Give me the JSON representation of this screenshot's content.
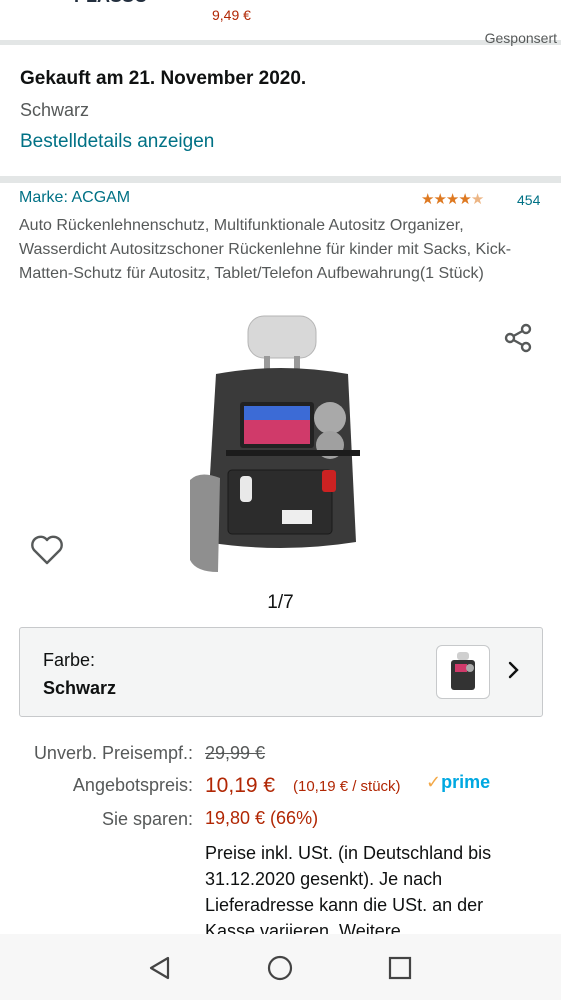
{
  "top": {
    "logo_text": "PLASSO",
    "price": "9,49 €",
    "sponsored": "Gesponsert"
  },
  "order": {
    "title": "Gekauft am 21. November 2020.",
    "color": "Schwarz",
    "details_link": "Bestelldetails anzeigen"
  },
  "product": {
    "brand": "Marke: ACGAM",
    "rating_stars": 4.5,
    "rating_count": "454",
    "title": "Auto Rückenlehnenschutz, Multifunktionale Autositz Organizer, Wasserdicht Autositzschoner Rückenlehne für kinder mit Sacks, Kick-Matten-Schutz für Autositz, Tablet/Telefon Aufbewahrung(1 Stück)",
    "image_counter": "1/7"
  },
  "color_selector": {
    "label": "Farbe:",
    "value": "Schwarz"
  },
  "pricing": {
    "list_label": "Unverb. Preisempf.:",
    "list_price": "29,99 €",
    "offer_label": "Angebotspreis:",
    "offer_price": "10,19 €",
    "unit_price": "(10,19 € / stück)",
    "prime": "prime",
    "savings_label": "Sie sparen:",
    "savings": "19,80 € (66%)",
    "tax_note": "Preise inkl. USt. (in Deutschland bis 31.12.2020 gesenkt). Je nach Lieferadresse kann die USt. an der Kasse variieren. Weitere"
  },
  "icons": {
    "share": "share-icon",
    "wishlist": "heart-icon",
    "chevron": "chevron-right-icon",
    "back": "back-icon",
    "home": "home-icon",
    "recent": "recent-apps-icon"
  },
  "colors": {
    "link": "#007185",
    "price": "#b12704",
    "star": "#de7921",
    "prime": "#00a8e1",
    "separator": "#e3e6e6"
  }
}
